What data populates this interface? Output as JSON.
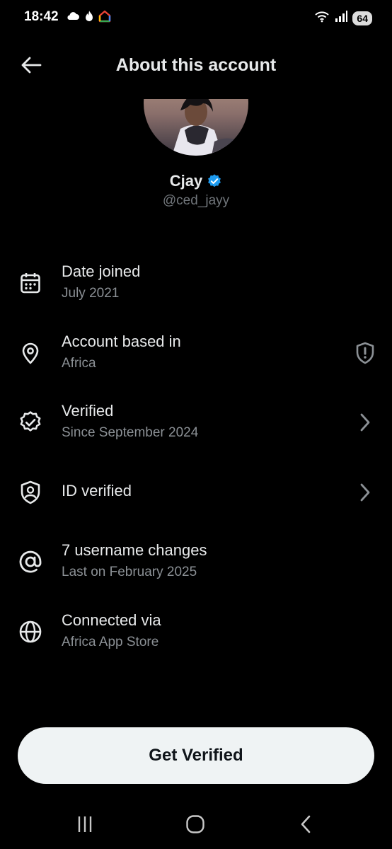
{
  "status_bar": {
    "time": "18:42",
    "battery": "64",
    "left_icons": [
      "cloud-icon",
      "flame-icon",
      "home-app-icon"
    ],
    "right_icons": [
      "wifi-icon",
      "signal-icon",
      "battery-icon"
    ]
  },
  "header": {
    "title": "About this account",
    "back_icon": "back-arrow-icon"
  },
  "profile": {
    "name": "Cjay",
    "handle": "@ced_jayy",
    "verified_badge_color": "#1d9bf0"
  },
  "rows": [
    {
      "icon": "calendar-icon",
      "title": "Date joined",
      "subtitle": "July 2021",
      "trailing": ""
    },
    {
      "icon": "location-pin-icon",
      "title": "Account based in",
      "subtitle": "Africa",
      "trailing": "shield-alert-icon"
    },
    {
      "icon": "verified-badge-icon",
      "title": "Verified",
      "subtitle": "Since September 2024",
      "trailing": "chevron-right-icon"
    },
    {
      "icon": "id-shield-icon",
      "title": "ID verified",
      "subtitle": "",
      "trailing": "chevron-right-icon"
    },
    {
      "icon": "at-sign-icon",
      "title": "7 username changes",
      "subtitle": "Last on February 2025",
      "trailing": ""
    },
    {
      "icon": "globe-icon",
      "title": "Connected via",
      "subtitle": "Africa App Store",
      "trailing": ""
    }
  ],
  "cta": {
    "label": "Get Verified"
  },
  "navbar": {
    "items": [
      "recents-icon",
      "home-icon",
      "back-icon"
    ]
  },
  "colors": {
    "background": "#000000",
    "primary_text": "#e7e9ea",
    "secondary_text": "#8b9095",
    "button_bg": "#eff3f4",
    "button_text": "#0f1419"
  }
}
